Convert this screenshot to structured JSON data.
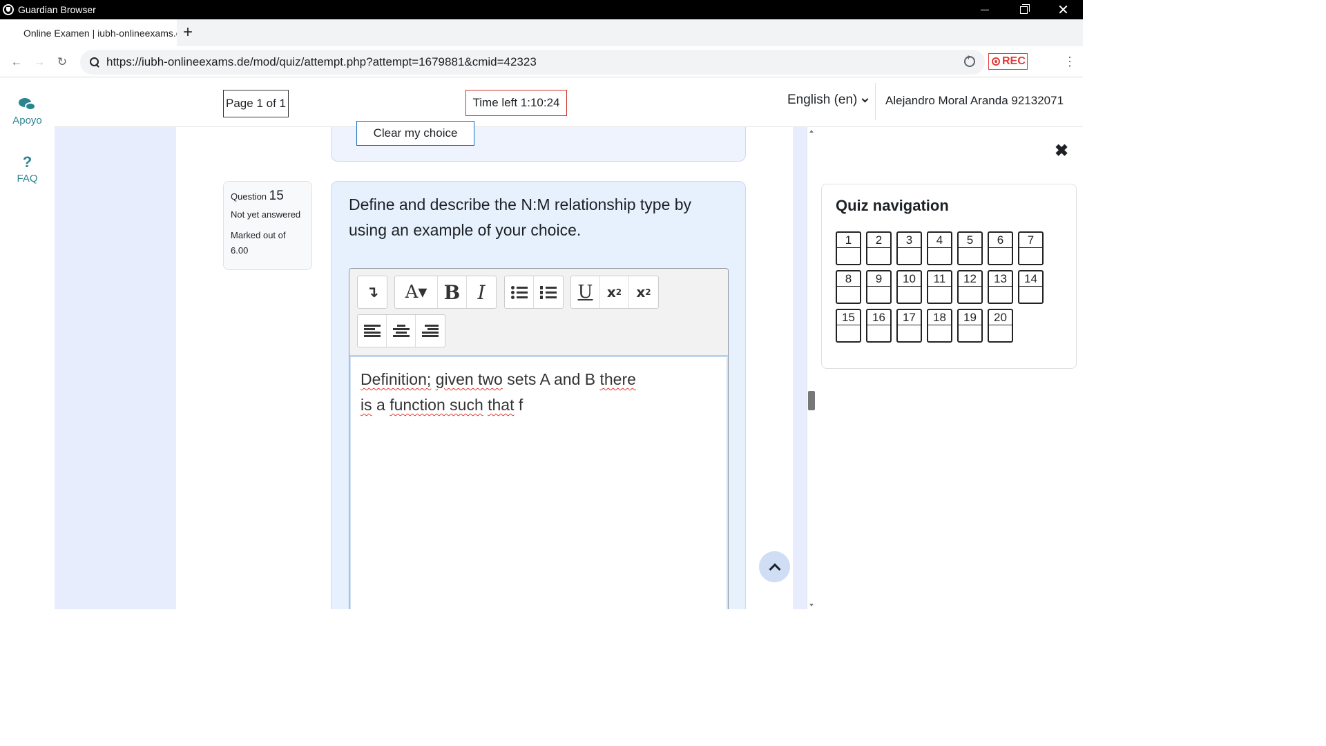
{
  "window": {
    "title": "Guardian Browser"
  },
  "tab": {
    "label": "Online Examen | iubh-onlineexams.c",
    "add_label": "+"
  },
  "address": {
    "url": "https://iubh-onlineexams.de/mod/quiz/attempt.php?attempt=1679881&cmid=42323",
    "rec_label": "REC"
  },
  "dock": {
    "support_label": "Apoyo",
    "faq_label": "FAQ",
    "faq_glyph": "?"
  },
  "header": {
    "page_indicator": "Page 1 of 1",
    "time_left": "Time left 1:10:24",
    "language": "English (en)",
    "user": "Alejandro Moral Aranda 92132071"
  },
  "previous_question": {
    "clear_label": "Clear my choice"
  },
  "question": {
    "label": "Question",
    "number": "15",
    "state": "Not yet answered",
    "marked_out_of": "Marked out of 6.00",
    "text": "Define and describe the N:M relationship type by using an example of your choice."
  },
  "editor": {
    "toolbar": {
      "expand": "↴",
      "font": "A▾",
      "bold": "B",
      "italic": "I",
      "underline": "U",
      "subscript": "x",
      "superscript": "x"
    },
    "answer_line1": [
      {
        "t": "Definition;",
        "err": true
      },
      {
        "t": " "
      },
      {
        "t": "given two",
        "err": true
      },
      {
        "t": " sets A and B  "
      },
      {
        "t": "there",
        "err": true
      }
    ],
    "answer_line2": [
      {
        "t": "is",
        "err": true
      },
      {
        "t": " a "
      },
      {
        "t": "function such",
        "err": true
      },
      {
        "t": " "
      },
      {
        "t": "that",
        "err": true
      },
      {
        "t": " f"
      }
    ]
  },
  "quiz_navigation": {
    "title": "Quiz navigation",
    "close_glyph": "✖",
    "questions": [
      "1",
      "2",
      "3",
      "4",
      "5",
      "6",
      "7",
      "8",
      "9",
      "10",
      "11",
      "12",
      "13",
      "14",
      "15",
      "16",
      "17",
      "18",
      "19",
      "20"
    ]
  },
  "colors": {
    "accent": "#2a8491",
    "timer_border": "#ca3120",
    "rec": "#e53935",
    "page_bg": "#e7edfc"
  },
  "icons": [
    "shield-icon",
    "back-icon",
    "forward-icon",
    "reload-icon",
    "search-icon",
    "zoom-icon",
    "rec-icon",
    "menu-icon",
    "chat-icon",
    "help-icon",
    "chevron-down-icon",
    "close-icon",
    "chevron-up-icon"
  ]
}
